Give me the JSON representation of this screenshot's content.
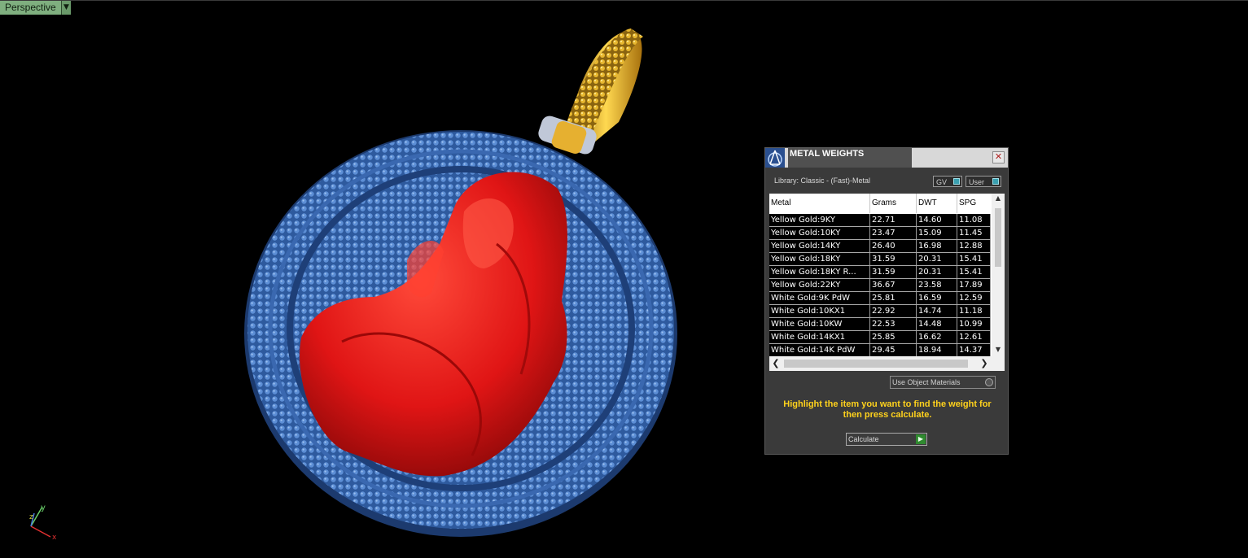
{
  "viewport": {
    "label": "Perspective",
    "dropdown_glyph": "▼",
    "axes": {
      "x": "x",
      "y": "y",
      "z": "z"
    }
  },
  "dialog": {
    "title": "METAL WEIGHTS",
    "close_glyph": "✕",
    "library": "Library: Classic - (Fast)-Metal",
    "gv_label": "GV",
    "user_label": "User",
    "columns": [
      "Metal",
      "Grams",
      "DWT",
      "SPG"
    ],
    "rows": [
      {
        "metal": "Yellow Gold:9KY",
        "grams": "22.71",
        "dwt": "14.60",
        "spg": "11.08"
      },
      {
        "metal": "Yellow Gold:10KY",
        "grams": "23.47",
        "dwt": "15.09",
        "spg": "11.45"
      },
      {
        "metal": "Yellow Gold:14KY",
        "grams": "26.40",
        "dwt": "16.98",
        "spg": "12.88"
      },
      {
        "metal": "Yellow Gold:18KY",
        "grams": "31.59",
        "dwt": "20.31",
        "spg": "15.41"
      },
      {
        "metal": "Yellow Gold:18KY R...",
        "grams": "31.59",
        "dwt": "20.31",
        "spg": "15.41"
      },
      {
        "metal": "Yellow Gold:22KY",
        "grams": "36.67",
        "dwt": "23.58",
        "spg": "17.89"
      },
      {
        "metal": "White Gold:9K PdW",
        "grams": "25.81",
        "dwt": "16.59",
        "spg": "12.59"
      },
      {
        "metal": "White Gold:10KX1",
        "grams": "22.92",
        "dwt": "14.74",
        "spg": "11.18"
      },
      {
        "metal": "White Gold:10KW",
        "grams": "22.53",
        "dwt": "14.48",
        "spg": "10.99"
      },
      {
        "metal": "White Gold:14KX1",
        "grams": "25.85",
        "dwt": "16.62",
        "spg": "12.61"
      },
      {
        "metal": "White Gold:14K PdW",
        "grams": "29.45",
        "dwt": "18.94",
        "spg": "14.37"
      }
    ],
    "use_object_materials": "Use Object Materials",
    "hint": "Highlight the item you want to find the weight for then press calculate.",
    "calculate_label": "Calculate"
  },
  "colors": {
    "background": "#000000",
    "bezel": "#4a78c0",
    "figure": "#e01515",
    "bail_gold": "#e0a820",
    "dialog_bg": "#3a3a3a",
    "hint_text": "#ffd21c"
  }
}
